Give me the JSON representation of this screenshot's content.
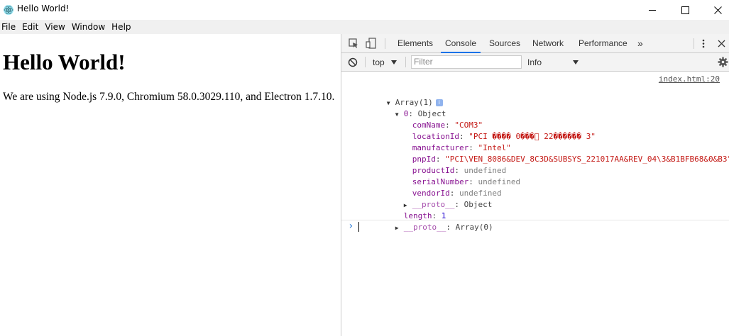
{
  "window": {
    "title": "Hello World!",
    "minimize_glyph": "minimize-icon",
    "maximize_glyph": "maximize-icon",
    "close_glyph": "close-icon"
  },
  "menu": [
    "File",
    "Edit",
    "View",
    "Window",
    "Help"
  ],
  "page": {
    "heading": "Hello World!",
    "paragraph": "We are using Node.js 7.9.0, Chromium 58.0.3029.110, and Electron 1.7.10."
  },
  "devtools": {
    "tabs": [
      "Elements",
      "Console",
      "Sources",
      "Network",
      "Performance"
    ],
    "active_tab": "Console",
    "more_tabs_glyph": "»",
    "context": "top",
    "filter_placeholder": "Filter",
    "level": "Info",
    "accent_color": "#1a73e8"
  },
  "console": {
    "source_link": "index.html:20",
    "lines": {
      "array_head": "Array(1)",
      "info": "i",
      "obj_key": "0",
      "obj_type": "Object",
      "comName_key": "comName",
      "comName_val": "\"COM3\"",
      "locationId_key": "locationId",
      "locationId_val": "\"PCI ���� 0���゙ 22������ 3\"",
      "manufacturer_key": "manufacturer",
      "manufacturer_val": "\"Intel\"",
      "pnpId_key": "pnpId",
      "pnpId_val": "\"PCI\\VEN_8086&DEV_8C3D&SUBSYS_221017AA&REV_04\\3&B1BFB68&0&B3\"",
      "productId_key": "productId",
      "productId_val": "undefined",
      "serialNumber_key": "serialNumber",
      "serialNumber_val": "undefined",
      "vendorId_key": "vendorId",
      "vendorId_val": "undefined",
      "proto_key": "__proto__",
      "proto_val": "Object",
      "length_key": "length",
      "length_val": "1",
      "proto2_key": "__proto__",
      "proto2_val": "Array(0)"
    },
    "prompt": "›"
  }
}
